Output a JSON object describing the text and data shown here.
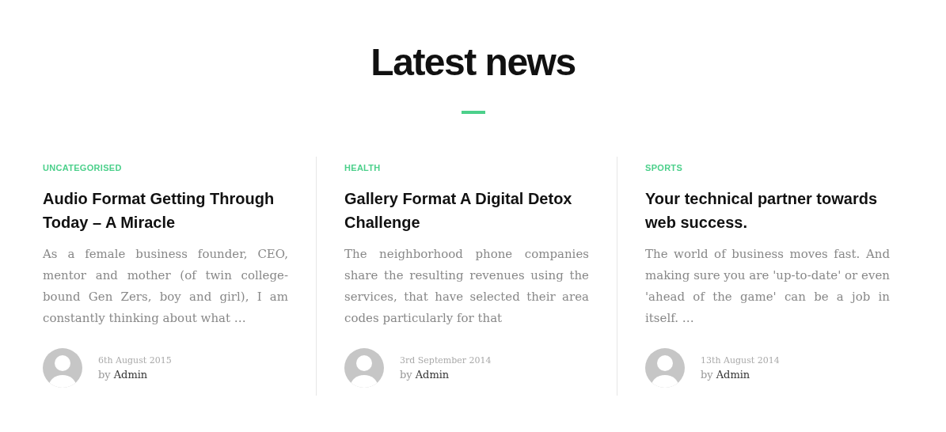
{
  "heading": "Latest news",
  "posts": [
    {
      "category": "UNCATEGORISED",
      "title": "Audio Format Getting Through Today – A Miracle",
      "excerpt": "As a female business founder, CEO, mentor and mother (of twin college-bound Gen Zers, boy and girl), I am constantly thinking about what …",
      "date": "6th August 2015",
      "by": "by",
      "author": "Admin"
    },
    {
      "category": "HEALTH",
      "title": "Gallery Format A Digital Detox Challenge",
      "excerpt": "The neighborhood phone companies share the resulting revenues using the services, that have selected their area codes particularly for that",
      "date": "3rd September 2014",
      "by": "by",
      "author": "Admin"
    },
    {
      "category": "SPORTS",
      "title": "Your technical partner towards web success.",
      "excerpt": "The world of business moves fast. And making sure you are 'up-to-date' or even 'ahead of the game' can be a job in itself. …",
      "date": "13th August 2014",
      "by": "by",
      "author": "Admin"
    }
  ]
}
